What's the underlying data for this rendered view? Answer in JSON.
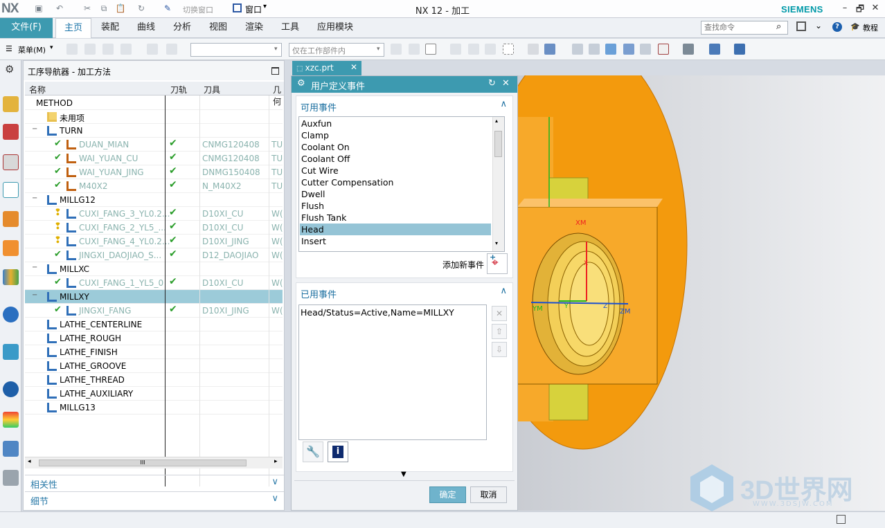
{
  "app": {
    "logo": "NX",
    "title": "NX 12 - 加工",
    "brand": "SIEMENS",
    "window_controls": [
      "–",
      "🗗",
      "✕"
    ]
  },
  "quick_access": {
    "switch_window": "切换窗口",
    "window_menu": "窗口"
  },
  "ribbon": {
    "file_tab": "文件(F)",
    "tabs": [
      "主页",
      "装配",
      "曲线",
      "分析",
      "视图",
      "渲染",
      "工具",
      "应用模块"
    ],
    "active_tab": "主页",
    "search_placeholder": "查找命令",
    "tutorial": "教程"
  },
  "toolbar": {
    "menu_label": "菜单(M)",
    "filter_combo": "",
    "scope_combo": "仅在工作部件内"
  },
  "navigator": {
    "title": "工序导航器 - 加工方法",
    "columns": [
      "名称",
      "刀轨",
      "刀具",
      "几何"
    ],
    "rows": [
      {
        "name": "METHOD",
        "indent": 0,
        "icon": "none",
        "grey": false
      },
      {
        "name": "未用项",
        "indent": 1,
        "icon": "folder",
        "grey": false
      },
      {
        "name": "TURN",
        "indent": 1,
        "icon": "method",
        "grey": false,
        "expand": "−"
      },
      {
        "name": "DUAN_MIAN",
        "indent": 2,
        "icon": "turn-op",
        "grey": true,
        "check": true,
        "tool": "CNMG120408",
        "geo": "TU"
      },
      {
        "name": "WAI_YUAN_CU",
        "indent": 2,
        "icon": "turn-op",
        "grey": true,
        "check": true,
        "tool": "CNMG120408",
        "geo": "TU"
      },
      {
        "name": "WAI_YUAN_JING",
        "indent": 2,
        "icon": "turn-op",
        "grey": true,
        "check": true,
        "tool": "DNMG150408",
        "geo": "TU"
      },
      {
        "name": "M40X2",
        "indent": 2,
        "icon": "thread-op",
        "grey": true,
        "check": true,
        "tool": "N_M40X2",
        "geo": "TU"
      },
      {
        "name": "MILLG12",
        "indent": 1,
        "icon": "method",
        "grey": false,
        "expand": "−"
      },
      {
        "name": "CUXI_FANG_3_YL0.2...",
        "indent": 2,
        "icon": "mill-op",
        "grey": true,
        "warn": true,
        "tool": "D10XI_CU",
        "geo": "W("
      },
      {
        "name": "CUXI_FANG_2_YL5_...",
        "indent": 2,
        "icon": "mill-op",
        "grey": true,
        "warn": true,
        "tool": "D10XI_CU",
        "geo": "W("
      },
      {
        "name": "CUXI_FANG_4_YL0.2...",
        "indent": 2,
        "icon": "mill-op",
        "grey": true,
        "warn": true,
        "tool": "D10XI_JING",
        "geo": "W("
      },
      {
        "name": "JINGXI_DAOJIAO_S...",
        "indent": 2,
        "icon": "mill-op",
        "grey": true,
        "check": true,
        "tool": "D12_DAOJIAO",
        "geo": "W("
      },
      {
        "name": "MILLXC",
        "indent": 1,
        "icon": "method",
        "grey": false,
        "expand": "−"
      },
      {
        "name": "CUXI_FANG_1_YL5_0",
        "indent": 2,
        "icon": "mill-op",
        "grey": true,
        "check": true,
        "tool": "D10XI_CU",
        "geo": "W("
      },
      {
        "name": "MILLXY",
        "indent": 1,
        "icon": "method",
        "grey": false,
        "expand": "−",
        "selected": true
      },
      {
        "name": "JINGXI_FANG",
        "indent": 2,
        "icon": "mill-op",
        "grey": true,
        "check": true,
        "tool": "D10XI_JING",
        "geo": "W("
      },
      {
        "name": "LATHE_CENTERLINE",
        "indent": 1,
        "icon": "method",
        "grey": false
      },
      {
        "name": "LATHE_ROUGH",
        "indent": 1,
        "icon": "method",
        "grey": false
      },
      {
        "name": "LATHE_FINISH",
        "indent": 1,
        "icon": "method",
        "grey": false
      },
      {
        "name": "LATHE_GROOVE",
        "indent": 1,
        "icon": "method",
        "grey": false
      },
      {
        "name": "LATHE_THREAD",
        "indent": 1,
        "icon": "method",
        "grey": false
      },
      {
        "name": "LATHE_AUXILIARY",
        "indent": 1,
        "icon": "method",
        "grey": false
      },
      {
        "name": "MILLG13",
        "indent": 1,
        "icon": "method",
        "grey": false
      }
    ],
    "sections": [
      "相关性",
      "细节"
    ],
    "scroll_mark": "III"
  },
  "file_tab": "xzc.prt",
  "dialog": {
    "title": "用户定义事件",
    "available_label": "可用事件",
    "events": [
      "Auxfun",
      "Clamp",
      "Coolant On",
      "Coolant Off",
      "Cut Wire",
      "Cutter Compensation",
      "Dwell",
      "Flush",
      "Flush Tank",
      "Head",
      "Insert"
    ],
    "selected_event": "Head",
    "add_new": "添加新事件",
    "used_label": "已用事件",
    "used_events": [
      "Head/Status=Active,Name=MILLXY"
    ],
    "ok": "确定",
    "cancel": "取消"
  },
  "viewport": {
    "axes": [
      "XM",
      "YM",
      "ZM",
      "X",
      "Y",
      "Z"
    ]
  },
  "watermark": {
    "text": "3D世界网",
    "url": "WWW.3DSJW.COM"
  },
  "colors": {
    "accent": "#3d9ab0",
    "part": "#f39a0d",
    "face": "#d7d23c",
    "check": "#2a9d2a",
    "grey_text": "#8ab3ae"
  }
}
